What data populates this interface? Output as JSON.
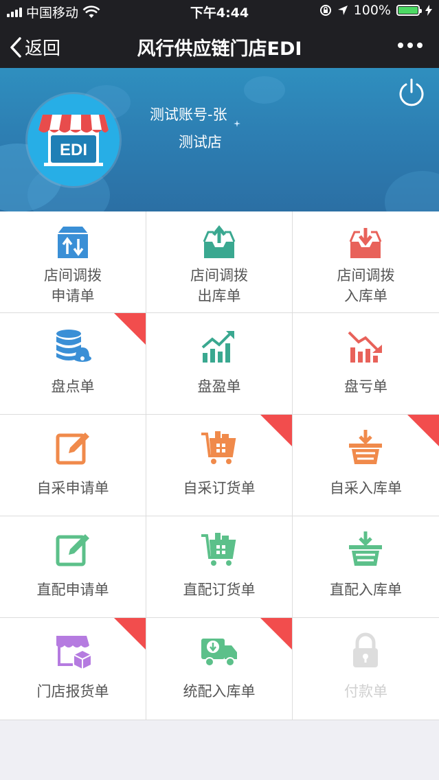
{
  "status_bar": {
    "carrier": "中国移动",
    "time": "下午4:44",
    "battery": "100%",
    "battery_level": 1.0
  },
  "nav": {
    "back_label": "返回",
    "title": "风行供应链门店EDI"
  },
  "profile": {
    "logo_text": "EDI",
    "account": "测试账号-张",
    "store": "测试店"
  },
  "colors": {
    "blue": "#3a8fd6",
    "teal": "#3aa890",
    "red": "#e8625a",
    "orange": "#f08a4b",
    "green": "#5cc08a",
    "purple": "#b57be0",
    "gray": "#dddddd",
    "corner": "#f24d4d"
  },
  "menu": [
    {
      "label": "店间调拨\n申请单",
      "icon": "transfer-box-icon",
      "badge": false
    },
    {
      "label": "店间调拨\n出库单",
      "icon": "tray-out-icon",
      "badge": false
    },
    {
      "label": "店间调拨\n入库单",
      "icon": "tray-in-icon",
      "badge": false
    },
    {
      "label": "盘点单",
      "icon": "database-bell-icon",
      "badge": true
    },
    {
      "label": "盘盈单",
      "icon": "chart-up-icon",
      "badge": false
    },
    {
      "label": "盘亏单",
      "icon": "chart-down-icon",
      "badge": false
    },
    {
      "label": "自采申请单",
      "icon": "edit-icon",
      "badge": false
    },
    {
      "label": "自采订货单",
      "icon": "cart-icon",
      "badge": true
    },
    {
      "label": "自采入库单",
      "icon": "basket-in-icon",
      "badge": true
    },
    {
      "label": "直配申请单",
      "icon": "edit-icon",
      "badge": false
    },
    {
      "label": "直配订货单",
      "icon": "cart-icon",
      "badge": false
    },
    {
      "label": "直配入库单",
      "icon": "basket-in-icon",
      "badge": false
    },
    {
      "label": "门店报货单",
      "icon": "store-box-icon",
      "badge": true
    },
    {
      "label": "统配入库单",
      "icon": "truck-icon",
      "badge": true
    },
    {
      "label": "付款单",
      "icon": "lock-icon",
      "badge": false,
      "disabled": true
    }
  ]
}
